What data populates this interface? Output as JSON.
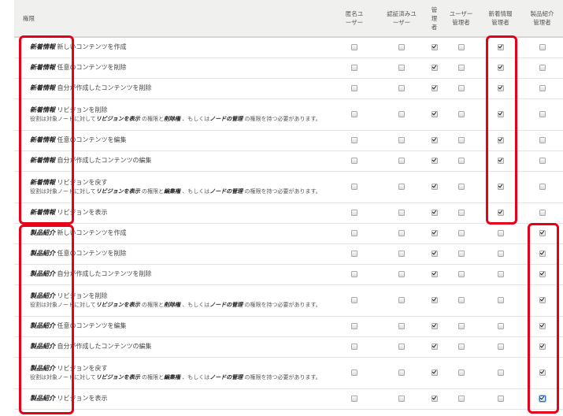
{
  "header": {
    "permission": "権限",
    "roles": [
      "匿名ユ\nーザー",
      "認証済みユ\nーザー",
      "管\n理\n者",
      "ユーザー\n管理者",
      "新着情報\n管理者",
      "製品紹介\n管理者"
    ]
  },
  "rows": [
    {
      "prefix": "新着情報",
      "action": "新しいコンテンツを作成",
      "checks": [
        false,
        false,
        true,
        false,
        true,
        false
      ]
    },
    {
      "prefix": "新着情報",
      "action": "任意のコンテンツを削除",
      "checks": [
        false,
        false,
        true,
        false,
        true,
        false
      ]
    },
    {
      "prefix": "新着情報",
      "action": "自分が作成したコンテンツを削除",
      "checks": [
        false,
        false,
        true,
        false,
        true,
        false
      ]
    },
    {
      "prefix": "新着情報",
      "action": "リビジョンを削除",
      "desc": [
        "役割は対象ノードに対して",
        "リビジョンを表示",
        "の権限と",
        "削除権",
        "、もしくは",
        "ノードの管理",
        "の権限を持つ必要があります。"
      ],
      "checks": [
        false,
        false,
        true,
        false,
        true,
        false
      ]
    },
    {
      "prefix": "新着情報",
      "action": "任意のコンテンツを編集",
      "checks": [
        false,
        false,
        true,
        false,
        true,
        false
      ]
    },
    {
      "prefix": "新着情報",
      "action": "自分が作成したコンテンツの編集",
      "checks": [
        false,
        false,
        true,
        false,
        true,
        false
      ]
    },
    {
      "prefix": "新着情報",
      "action": "リビジョンを戻す",
      "desc": [
        "役割は対象ノードに対して",
        "リビジョンを表示",
        "の権限と",
        "編集権",
        "、もしくは",
        "ノードの管理",
        "の権限を持つ必要があります。"
      ],
      "checks": [
        false,
        false,
        true,
        false,
        true,
        false
      ]
    },
    {
      "prefix": "新着情報",
      "action": "リビジョンを表示",
      "checks": [
        false,
        false,
        true,
        false,
        true,
        false
      ]
    },
    {
      "prefix": "製品紹介",
      "action": "新しいコンテンツを作成",
      "checks": [
        false,
        false,
        true,
        false,
        false,
        true
      ]
    },
    {
      "prefix": "製品紹介",
      "action": "任意のコンテンツを削除",
      "checks": [
        false,
        false,
        true,
        false,
        false,
        true
      ]
    },
    {
      "prefix": "製品紹介",
      "action": "自分が作成したコンテンツを削除",
      "checks": [
        false,
        false,
        true,
        false,
        false,
        true
      ]
    },
    {
      "prefix": "製品紹介",
      "action": "リビジョンを削除",
      "desc": [
        "役割は対象ノードに対して",
        "リビジョンを表示",
        "の権限と",
        "削除権",
        "、もしくは",
        "ノードの管理",
        "の権限を持つ必要があります。"
      ],
      "checks": [
        false,
        false,
        true,
        false,
        false,
        true
      ]
    },
    {
      "prefix": "製品紹介",
      "action": "任意のコンテンツを編集",
      "checks": [
        false,
        false,
        true,
        false,
        false,
        true
      ]
    },
    {
      "prefix": "製品紹介",
      "action": "自分が作成したコンテンツの編集",
      "checks": [
        false,
        false,
        true,
        false,
        false,
        true
      ]
    },
    {
      "prefix": "製品紹介",
      "action": "リビジョンを戻す",
      "desc": [
        "役割は対象ノードに対して",
        "リビジョンを表示",
        "の権限と",
        "編集権",
        "、もしくは",
        "ノードの管理",
        "の権限を持つ必要があります。"
      ],
      "checks": [
        false,
        false,
        true,
        false,
        false,
        true
      ]
    },
    {
      "prefix": "製品紹介",
      "action": "リビジョンを表示",
      "checks": [
        false,
        false,
        true,
        false,
        false,
        true
      ]
    }
  ],
  "colors": {
    "highlight": "#e8001a",
    "header_bg": "#f0f0ee"
  }
}
